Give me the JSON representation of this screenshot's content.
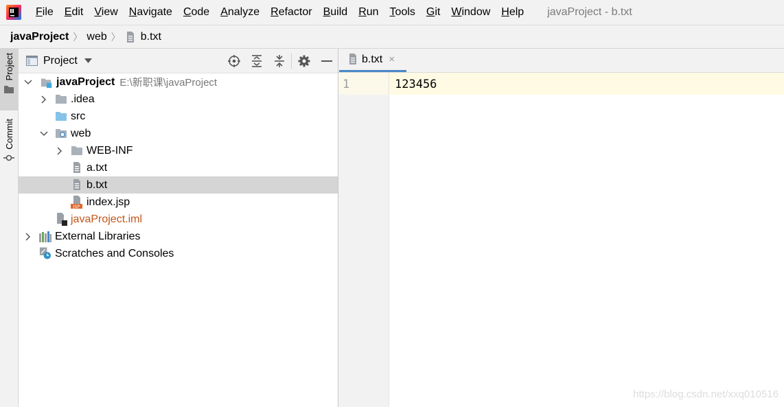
{
  "app": {
    "icon": "intellij-idea-icon",
    "window_title": "javaProject - b.txt",
    "menu": [
      "File",
      "Edit",
      "View",
      "Navigate",
      "Code",
      "Analyze",
      "Refactor",
      "Build",
      "Run",
      "Tools",
      "Git",
      "Window",
      "Help"
    ]
  },
  "breadcrumb": {
    "items": [
      {
        "label": "javaProject",
        "icon": null
      },
      {
        "label": "web",
        "icon": null
      },
      {
        "label": "b.txt",
        "icon": "text-file-icon"
      }
    ]
  },
  "left_strip": {
    "tabs": [
      {
        "label": "Project",
        "icon": "folder-icon",
        "active": true
      },
      {
        "label": "Commit",
        "icon": "commit-icon",
        "active": false
      }
    ]
  },
  "project_panel": {
    "title": "Project",
    "tools": [
      "locate-icon",
      "expand-all-icon",
      "collapse-all-icon",
      "gear-icon",
      "hide-icon"
    ],
    "tree": [
      {
        "label": "javaProject",
        "path": "E:\\新职课\\javaProject",
        "icon": "module-folder-icon",
        "arrow": "down",
        "depth": 0,
        "bold": true
      },
      {
        "label": ".idea",
        "icon": "folder-icon",
        "arrow": "right",
        "depth": 1
      },
      {
        "label": "src",
        "icon": "source-folder-icon",
        "arrow": "none",
        "depth": 1
      },
      {
        "label": "web",
        "icon": "web-folder-icon",
        "arrow": "down",
        "depth": 1
      },
      {
        "label": "WEB-INF",
        "icon": "folder-icon",
        "arrow": "right",
        "depth": 2
      },
      {
        "label": "a.txt",
        "icon": "text-file-icon",
        "arrow": "none",
        "depth": 2
      },
      {
        "label": "b.txt",
        "icon": "text-file-icon",
        "arrow": "none",
        "depth": 2,
        "selected": true
      },
      {
        "label": "index.jsp",
        "icon": "jsp-file-icon",
        "arrow": "none",
        "depth": 2
      },
      {
        "label": "javaProject.iml",
        "icon": "iml-file-icon",
        "arrow": "none",
        "depth": 1,
        "iml": true
      },
      {
        "label": "External Libraries",
        "icon": "libraries-icon",
        "arrow": "right",
        "depth": 0
      },
      {
        "label": "Scratches and Consoles",
        "icon": "scratches-icon",
        "arrow": "none",
        "depth": 0
      }
    ]
  },
  "editor": {
    "tab": {
      "label": "b.txt",
      "icon": "text-file-icon",
      "close": "×"
    },
    "line_number": "1",
    "content": "123456"
  },
  "watermark": "https://blog.csdn.net/xxq010516",
  "colors": {
    "selection": "#d5d5d5",
    "accent": "#4a88c7",
    "folder": "#a9b1ba",
    "source_folder": "#87c3e8",
    "iml_text": "#c0561b",
    "current_line": "#fffae3"
  }
}
